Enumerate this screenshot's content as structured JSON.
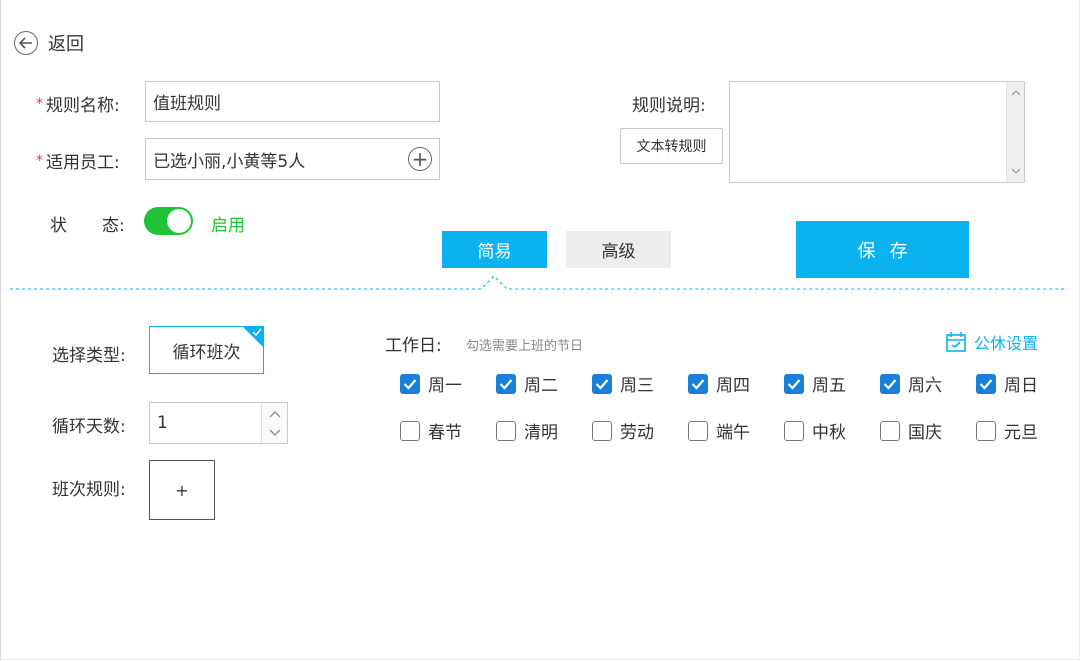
{
  "header": {
    "back_label": "返回"
  },
  "form": {
    "rule_name": {
      "label": "规则名称:",
      "value": "值班规则"
    },
    "employees": {
      "label": "适用员工:",
      "value": "已选小丽,小黄等5人"
    },
    "status": {
      "label_a": "状",
      "label_b": "态:",
      "value": "启用",
      "enabled": true
    },
    "description": {
      "label": "规则说明:",
      "convert_button": "文本转规则"
    }
  },
  "tabs": [
    {
      "label": "简易",
      "active": true
    },
    {
      "label": "高级",
      "active": false
    }
  ],
  "save_label": "保存",
  "left_panel": {
    "type_label": "选择类型:",
    "type_value": "循环班次",
    "cycle_days_label": "循环天数:",
    "cycle_days_value": "1",
    "shift_rule_label": "班次规则:",
    "shift_add": "+"
  },
  "workdays": {
    "label": "工作日:",
    "hint": "勾选需要上班的节日",
    "holiday_link": "公休设置",
    "week": [
      {
        "label": "周一",
        "checked": true
      },
      {
        "label": "周二",
        "checked": true
      },
      {
        "label": "周三",
        "checked": true
      },
      {
        "label": "周四",
        "checked": true
      },
      {
        "label": "周五",
        "checked": true
      },
      {
        "label": "周六",
        "checked": true
      },
      {
        "label": "周日",
        "checked": true
      }
    ],
    "holidays": [
      {
        "label": "春节",
        "checked": false
      },
      {
        "label": "清明",
        "checked": false
      },
      {
        "label": "劳动",
        "checked": false
      },
      {
        "label": "端午",
        "checked": false
      },
      {
        "label": "中秋",
        "checked": false
      },
      {
        "label": "国庆",
        "checked": false
      },
      {
        "label": "元旦",
        "checked": false
      }
    ]
  },
  "colors": {
    "accent": "#0ab3ef",
    "toggle_on": "#1ec337",
    "check": "#1a7fd8",
    "required": "#e23b3b"
  }
}
